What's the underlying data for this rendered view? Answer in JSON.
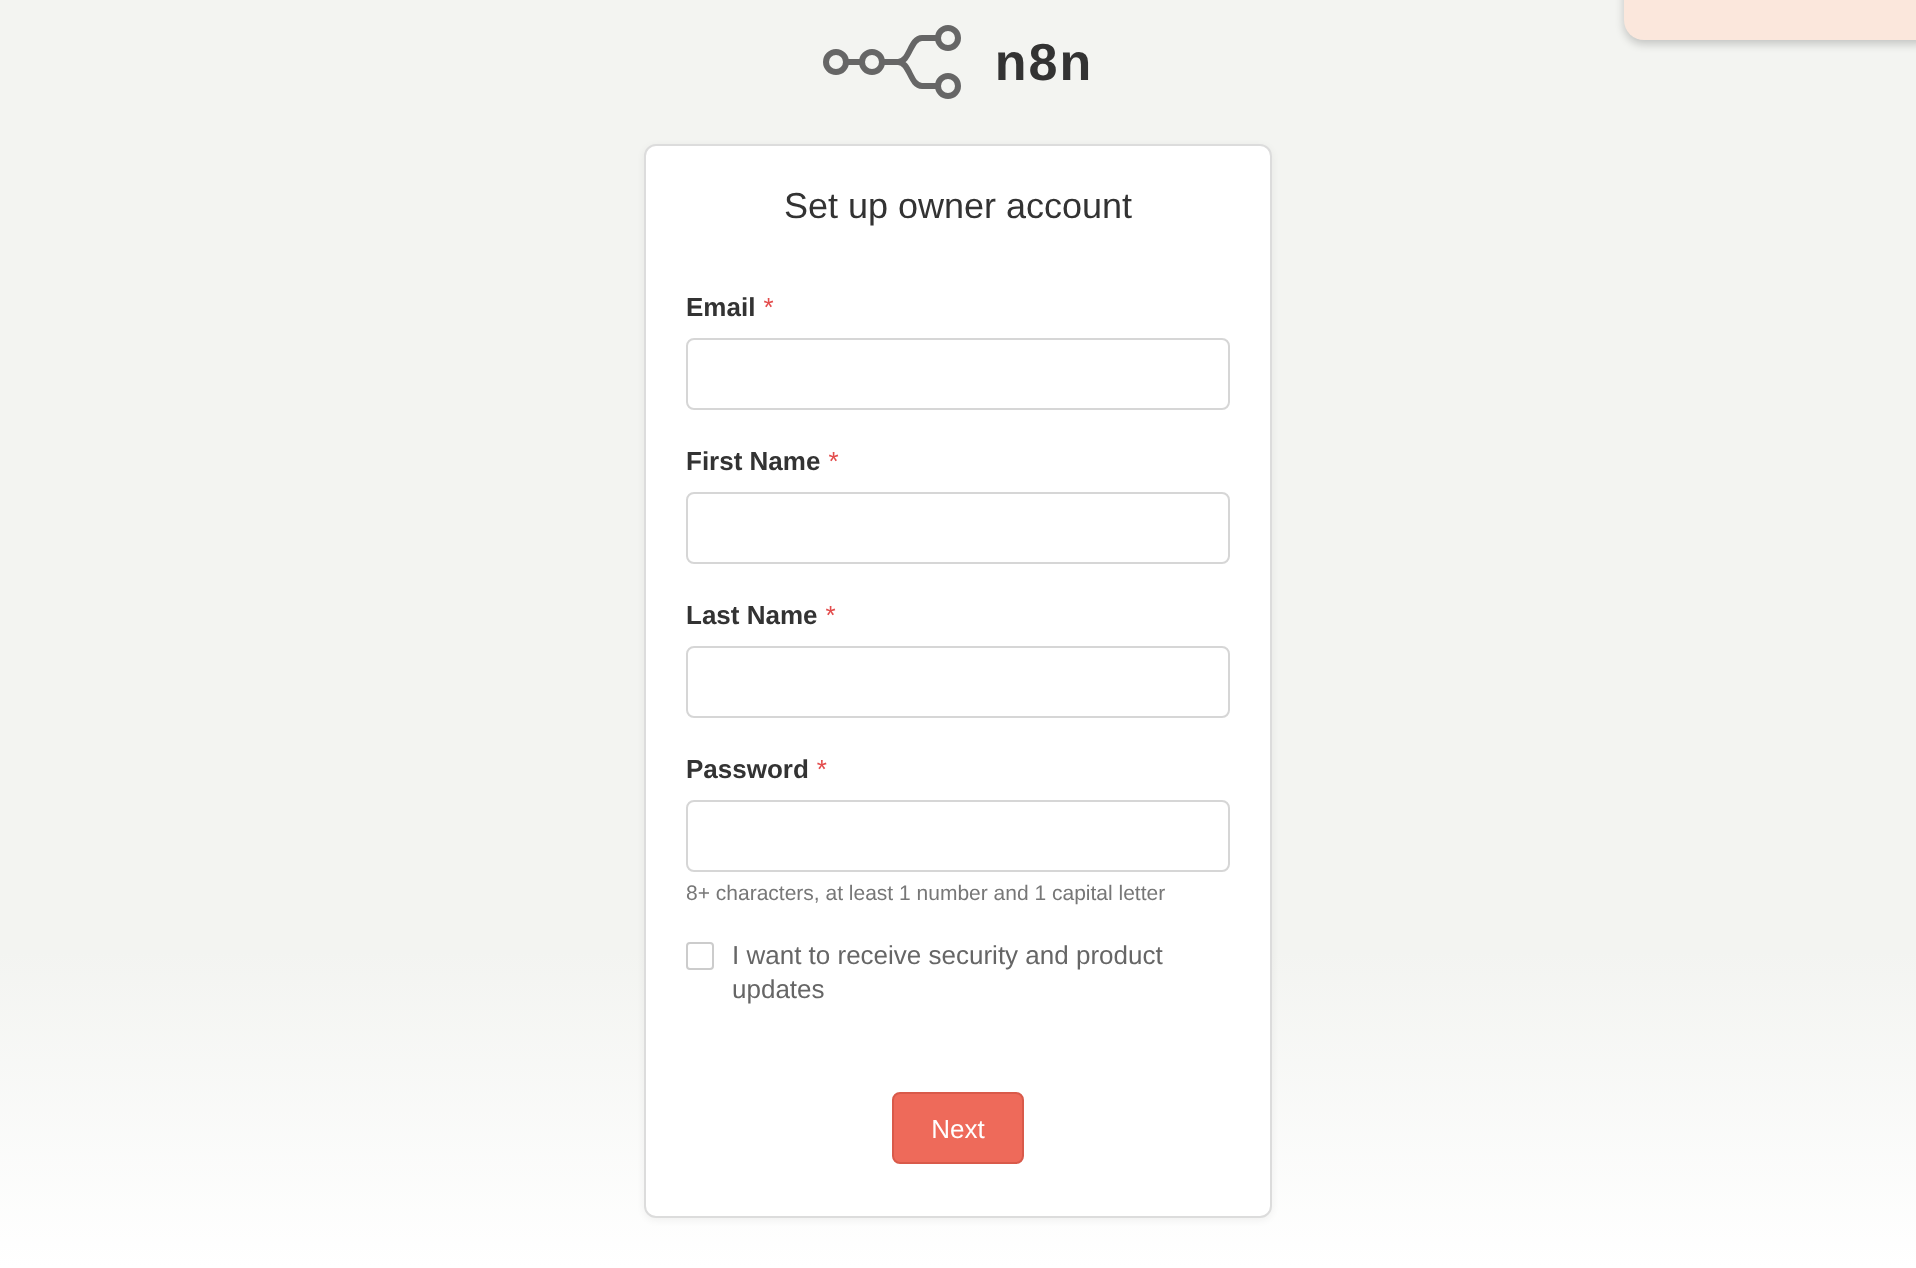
{
  "logo": {
    "text": "n8n"
  },
  "form": {
    "title": "Set up owner account",
    "fields": [
      {
        "label": "Email",
        "required_mark": "*"
      },
      {
        "label": "First Name",
        "required_mark": "*"
      },
      {
        "label": "Last Name",
        "required_mark": "*"
      },
      {
        "label": "Password",
        "required_mark": "*",
        "hint": "8+ characters, at least 1 number and 1 capital letter"
      }
    ],
    "checkbox": {
      "label": "I want to receive security and product updates",
      "checked": false
    },
    "submit": "Next"
  }
}
